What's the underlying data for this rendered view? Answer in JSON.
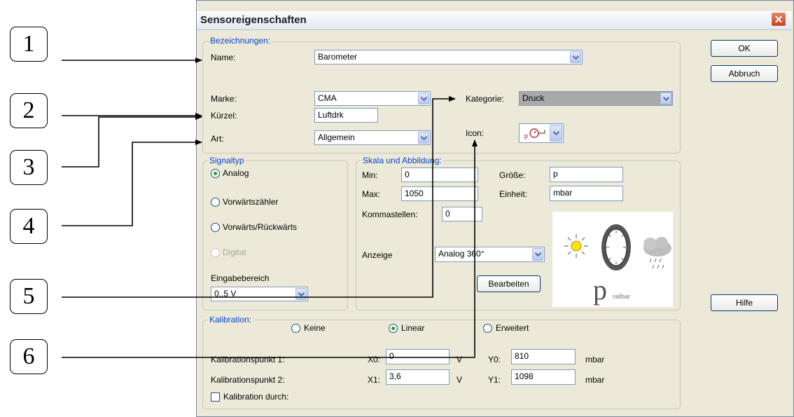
{
  "dialog": {
    "title": "Sensoreigenschaften",
    "close_glyph": "✕",
    "buttons": {
      "ok": "OK",
      "cancel": "Abbruch",
      "help": "Hilfe"
    }
  },
  "callouts": [
    "1",
    "2",
    "3",
    "4",
    "5",
    "6"
  ],
  "bezeichnungen": {
    "legend": "Bezeichnungen:",
    "name_label": "Name:",
    "name_value": "Barometer",
    "marke_label": "Marke:",
    "marke_value": "CMA",
    "kuerzel_label": "Kürzel:",
    "kuerzel_value": "Luftdrk",
    "art_label": "Art:",
    "art_value": "Allgemein",
    "kategorie_label": "Kategorie:",
    "kategorie_value": "Druck",
    "icon_label": "Icon:",
    "icon_preview": "p-gauge-icon"
  },
  "signaltyp": {
    "legend": "Signaltyp",
    "options": [
      {
        "label": "Analog",
        "selected": true,
        "disabled": false
      },
      {
        "label": "Vorwärtszähler",
        "selected": false,
        "disabled": false
      },
      {
        "label": "Vorwärts/Rückwärts",
        "selected": false,
        "disabled": false
      },
      {
        "label": "Digital",
        "selected": false,
        "disabled": true
      }
    ],
    "eingabe_label": "Eingabebereich",
    "eingabe_value": "0..5 V"
  },
  "skala": {
    "legend": "Skala und Abbildung:",
    "min_label": "Min:",
    "min_value": "0",
    "max_label": "Max:",
    "max_value": "1050",
    "komma_label": "Kommastellen:",
    "komma_value": "0",
    "groesse_label": "Größe:",
    "groesse_value": "p",
    "einheit_label": "Einheit:",
    "einheit_value": "mbar",
    "anzeige_label": "Anzeige",
    "anzeige_value": "Analog 360°",
    "bearbeiten": "Bearbeiten",
    "preview_p": "p",
    "preview_caption": "rallbar"
  },
  "kalibration": {
    "legend": "Kalibration:",
    "options": [
      {
        "label": "Keine",
        "selected": false
      },
      {
        "label": "Linear",
        "selected": true
      },
      {
        "label": "Erweitert",
        "selected": false
      }
    ],
    "p1_label": "Kalibrationspunkt 1:",
    "p2_label": "Kalibrationspunkt 2:",
    "x0_label": "X0:",
    "x0_value": "0",
    "x0_unit": "V",
    "x1_label": "X1:",
    "x1_value": "3,6",
    "x1_unit": "V",
    "y0_label": "Y0:",
    "y0_value": "810",
    "y0_unit": "mbar",
    "y1_label": "Y1:",
    "y1_value": "1098",
    "y1_unit": "mbar",
    "durch_label": "Kalibration durch:"
  }
}
